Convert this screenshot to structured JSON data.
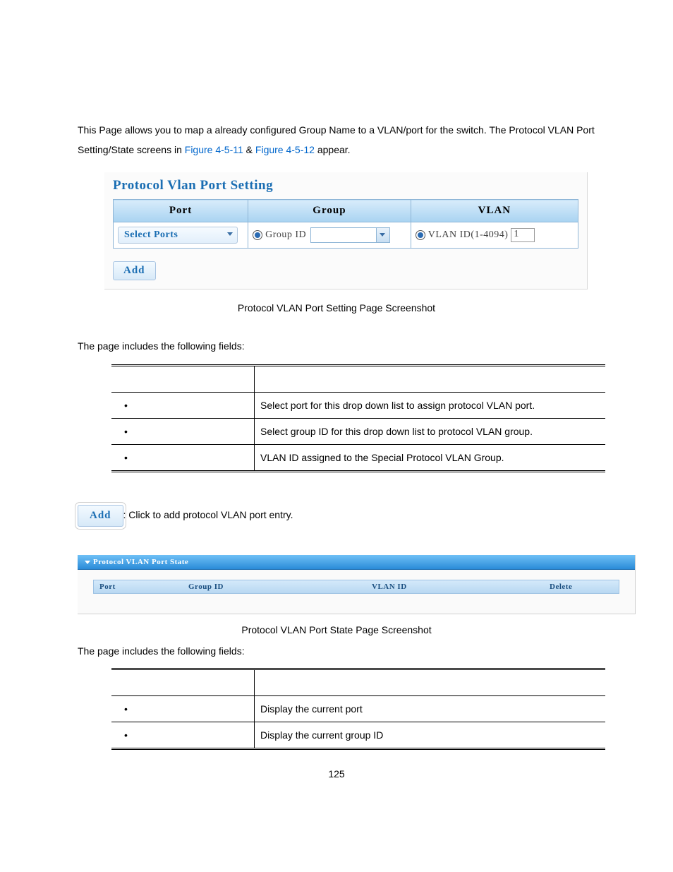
{
  "intro": {
    "part1": "This Page allows you to map a already configured Group Name to a VLAN/port for the switch. The Protocol VLAN Port Setting/State screens in ",
    "link1": "Figure 4-5-11",
    "amp": " & ",
    "link2": "Figure 4-5-12",
    "part2": " appear."
  },
  "setting": {
    "title": "Protocol Vlan Port Setting",
    "headers": {
      "port": "Port",
      "group": "Group",
      "vlan": "VLAN"
    },
    "select_ports": "Select Ports",
    "group_label": "Group ID",
    "vlan_label": "VLAN ID(1-4094)",
    "vlan_value": "1",
    "add_label": "Add"
  },
  "caption1": "Protocol VLAN Port Setting Page Screenshot",
  "fields_intro": "The page includes the following fields:",
  "fields1": [
    {
      "bullet": " ",
      "desc": "Select port for this drop down list to assign protocol VLAN port."
    },
    {
      "bullet": " ",
      "desc": "Select group ID for this drop down list to protocol VLAN group."
    },
    {
      "bullet": " ",
      "desc": "VLAN ID assigned to the Special Protocol VLAN Group."
    }
  ],
  "add_inline": {
    "label": "Add",
    "desc": ": Click to add protocol VLAN port entry."
  },
  "state": {
    "header": "Protocol VLAN Port State",
    "cols": {
      "port": "Port",
      "group": "Group ID",
      "vlan": "VLAN ID",
      "delete": "Delete"
    }
  },
  "caption2": "Protocol VLAN Port State Page Screenshot",
  "fields2_intro": "The page includes the following fields:",
  "fields2": [
    {
      "bullet": " ",
      "desc": "Display the current port"
    },
    {
      "bullet": " ",
      "desc": "Display the current group ID"
    }
  ],
  "page_number": "125"
}
